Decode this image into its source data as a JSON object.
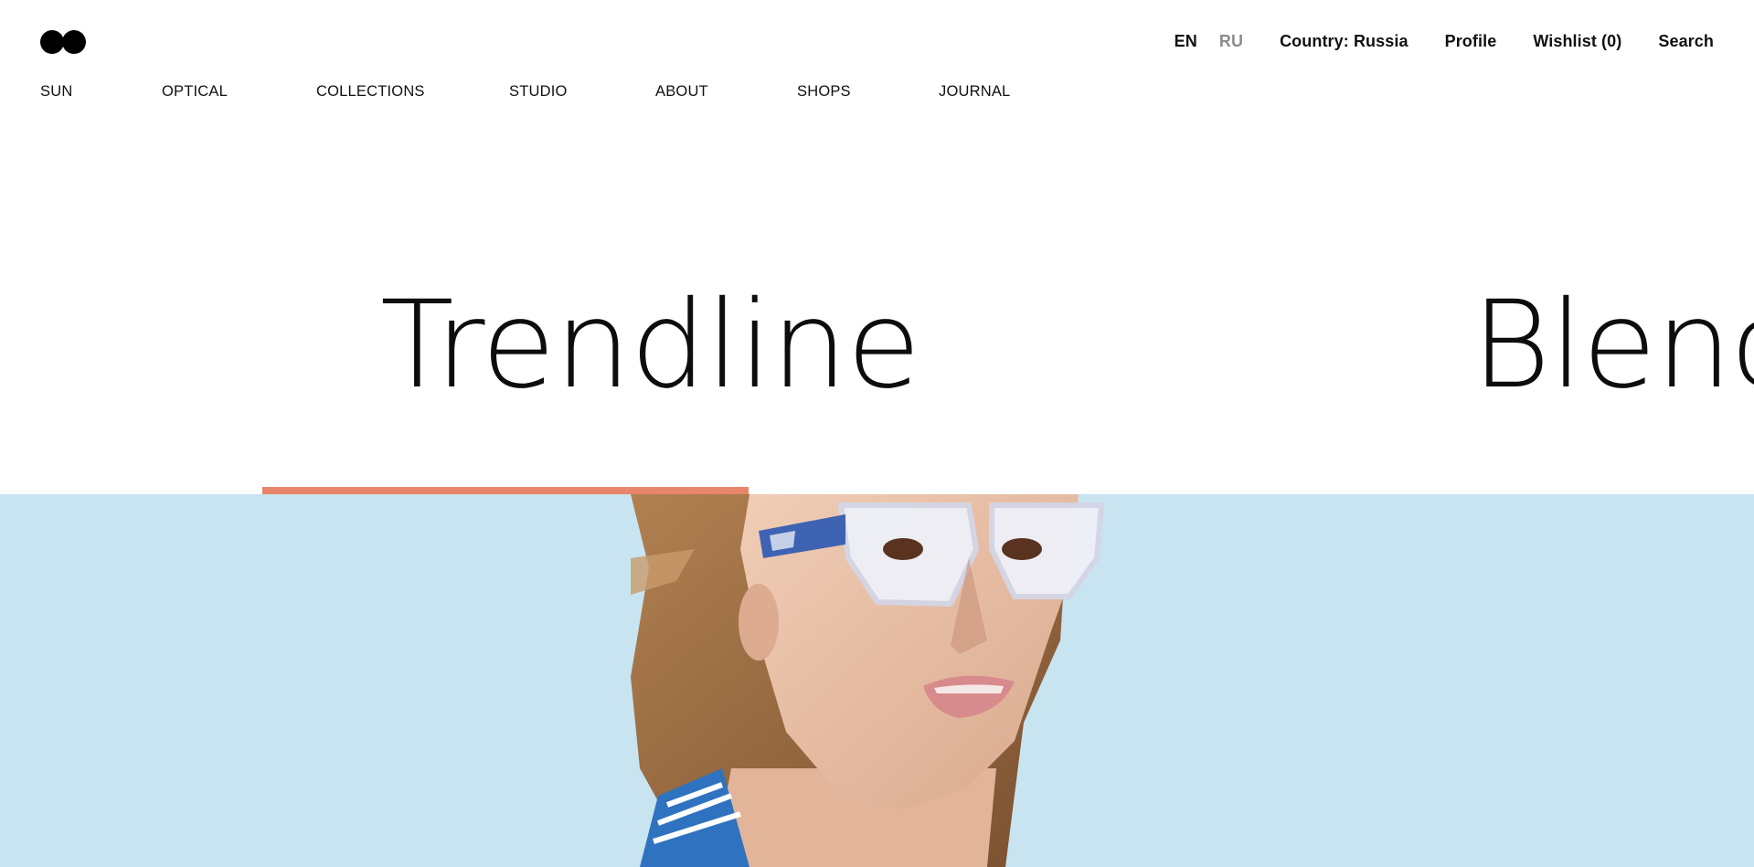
{
  "header": {
    "lang_en": "EN",
    "lang_ru": "RU",
    "country": "Country: Russia",
    "profile": "Profile",
    "wishlist": "Wishlist (0)",
    "search": "Search"
  },
  "nav": {
    "items": [
      {
        "label": "SUN"
      },
      {
        "label": "OPTICAL"
      },
      {
        "label": "COLLECTIONS"
      },
      {
        "label": "STUDIO"
      },
      {
        "label": "ABOUT"
      },
      {
        "label": "SHOPS"
      },
      {
        "label": "JOURNAL"
      }
    ]
  },
  "hero": {
    "slides": [
      {
        "title": "Trendline"
      },
      {
        "title": "Blenc"
      }
    ],
    "accent_color": "#e8856b",
    "band_color": "#c8e4f0"
  },
  "icons": {
    "logo": "two-circles-logo-icon"
  }
}
